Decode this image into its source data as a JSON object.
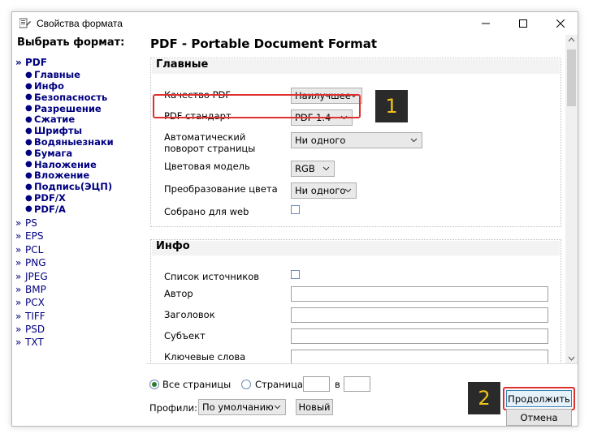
{
  "window": {
    "title": "Свойства формата"
  },
  "left": {
    "heading": "Выбрать формат:",
    "active_format": "PDF",
    "pdf_children": [
      "Главные",
      "Инфо",
      "Безопасность",
      "Разрешение",
      "Сжатие",
      "Шрифты",
      "Водяныезнаки",
      "Бумага",
      "Наложение",
      "Вложение",
      "Подпись(ЭЦП)",
      "PDF/X",
      "PDF/A"
    ],
    "other_formats": [
      "PS",
      "EPS",
      "PCL",
      "PNG",
      "JPEG",
      "BMP",
      "PCX",
      "TIFF",
      "PSD",
      "TXT"
    ]
  },
  "main": {
    "title": "PDF - Portable Document Format",
    "general": {
      "title": "Главные",
      "quality_label": "Качество PDF",
      "quality_value": "Наилучшее",
      "standard_label": "PDF стандарт",
      "standard_value": "PDF 1.4",
      "rotate_label_1": "Автоматический",
      "rotate_label_2": "поворот страницы",
      "rotate_value": "Ни одного",
      "color_label": "Цветовая модель",
      "color_value": "RGB",
      "conversion_label": "Преобразование цвета",
      "conversion_value": "Ни одного",
      "web_label": "Собрано для web"
    },
    "info": {
      "title": "Инфо",
      "sources_label": "Список источников",
      "author_label": "Автор",
      "heading_label": "Заголовок",
      "subject_label": "Субъект",
      "keywords_label": "Ключевые слова"
    }
  },
  "bottom": {
    "all_pages": "Все страницы",
    "page": "Страница",
    "in": "в",
    "profiles_label": "Профили:",
    "profile_value": "По умолчанию",
    "new_button": "Новый",
    "continue_button": "Продолжить",
    "cancel_button": "Отмена"
  },
  "annotations": {
    "badge1": "1",
    "badge2": "2",
    "highlight_color": "#e03030"
  }
}
